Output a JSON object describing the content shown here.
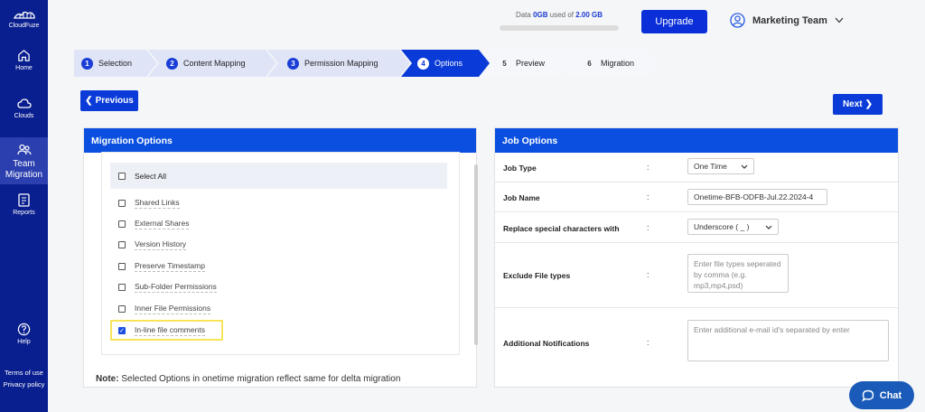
{
  "brand": {
    "name": "CloudFuze"
  },
  "sidebar": {
    "items": [
      {
        "label": "Home",
        "icon": "home-icon"
      },
      {
        "label": "Clouds",
        "icon": "cloud-icon"
      },
      {
        "label": "Team Migration",
        "icon": "team-icon"
      },
      {
        "label": "Reports",
        "icon": "reports-icon"
      },
      {
        "label": "Help",
        "icon": "help-icon"
      }
    ],
    "footer": {
      "terms": "Terms of use",
      "privacy": "Privacy policy"
    }
  },
  "header": {
    "data_prefix": "Data",
    "data_used": "0GB",
    "data_mid": "used of",
    "data_total": "2.00 GB",
    "data_progress": 0,
    "upgrade_label": "Upgrade",
    "user_name": "Marketing Team"
  },
  "steps": [
    {
      "num": "1",
      "label": "Selection"
    },
    {
      "num": "2",
      "label": "Content Mapping"
    },
    {
      "num": "3",
      "label": "Permission Mapping"
    },
    {
      "num": "4",
      "label": "Options"
    },
    {
      "num": "5",
      "label": "Preview"
    },
    {
      "num": "6",
      "label": "Migration"
    }
  ],
  "nav": {
    "previous": "Previous",
    "next": "Next"
  },
  "migration_options": {
    "title": "Migration Options",
    "select_all": "Select All",
    "options": [
      {
        "label": "Shared Links",
        "checked": false
      },
      {
        "label": "External Shares",
        "checked": false
      },
      {
        "label": "Version History",
        "checked": false
      },
      {
        "label": "Preserve Timestamp",
        "checked": false
      },
      {
        "label": "Sub-Folder Permissions",
        "checked": false
      },
      {
        "label": "Inner File Permissions",
        "checked": false
      },
      {
        "label": "In-line file comments",
        "checked": true
      }
    ],
    "note_label": "Note:",
    "note_text": "Selected Options in onetime migration reflect same for delta migration"
  },
  "job_options": {
    "title": "Job Options",
    "colon": ":",
    "job_type_label": "Job Type",
    "job_type_value": "One Time",
    "job_name_label": "Job Name",
    "job_name_value": "Onetime-BFB-ODFB-Jul.22.2024-4",
    "replace_label": "Replace special characters with",
    "replace_value": "Underscore ( _ )",
    "exclude_label": "Exclude File types",
    "exclude_placeholder": "Enter file types seperated by comma (e.g. mp3,mp4,psd)",
    "notify_label": "Additional Notifications",
    "notify_placeholder": "Enter additional e-mail id's separated by enter"
  },
  "chat": {
    "label": "Chat"
  },
  "colors": {
    "sidebar": "#0a1f8f",
    "primary": "#0a3bd8",
    "header": "#0a4fe0",
    "highlight": "#f7e45b"
  }
}
